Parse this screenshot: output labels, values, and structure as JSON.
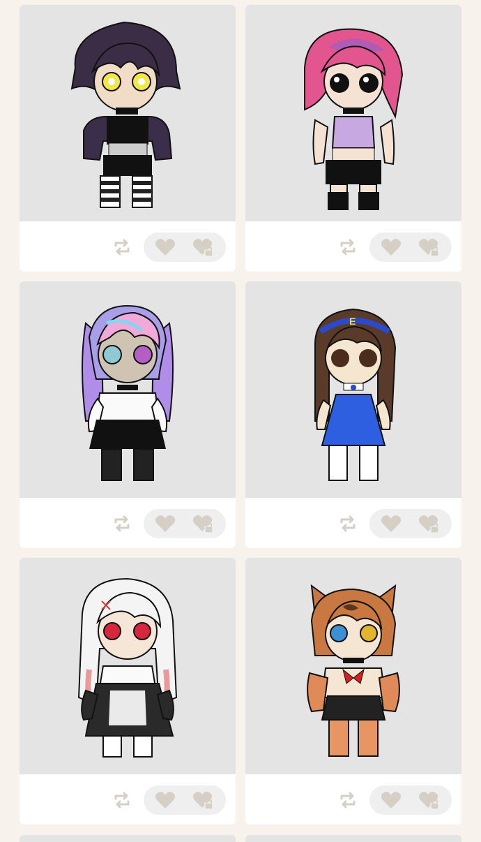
{
  "colors": {
    "background": "#f7f3ec",
    "card": "#ffffff",
    "art_bg": "#e4e4e4",
    "icon": "#d6cfc6",
    "pill": "#efefef"
  },
  "cards": [
    {
      "name": "purple-hoodie-character",
      "icons": [
        "repost-icon",
        "heart-icon",
        "heart-lock-icon"
      ]
    },
    {
      "name": "pink-hair-character",
      "icons": [
        "repost-icon",
        "heart-icon",
        "heart-lock-icon"
      ]
    },
    {
      "name": "pastel-twintails-character",
      "icons": [
        "repost-icon",
        "heart-icon",
        "heart-lock-icon"
      ]
    },
    {
      "name": "blue-dress-character",
      "icons": [
        "repost-icon",
        "heart-icon",
        "heart-lock-icon"
      ]
    },
    {
      "name": "white-hair-gothic-character",
      "icons": [
        "repost-icon",
        "heart-icon",
        "heart-lock-icon"
      ]
    },
    {
      "name": "cat-ear-character",
      "icons": [
        "repost-icon",
        "heart-icon",
        "heart-lock-icon"
      ]
    }
  ]
}
